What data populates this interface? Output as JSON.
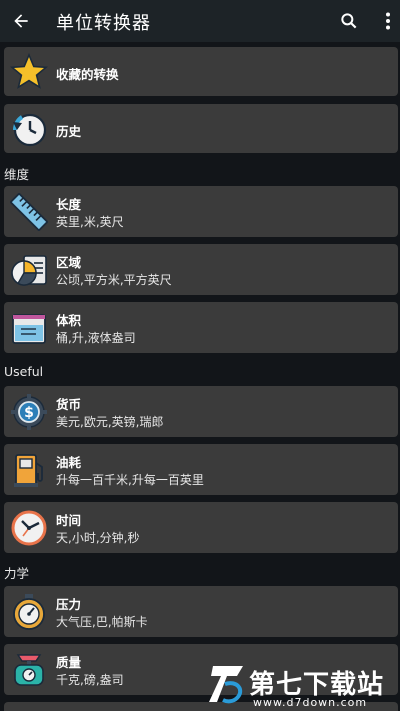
{
  "header": {
    "title": "单位转换器",
    "back_icon": "arrow-left-icon",
    "search_icon": "search-icon",
    "more_icon": "more-vert-icon"
  },
  "top_items": [
    {
      "name": "收藏的转换",
      "icon": "star-icon"
    },
    {
      "name": "历史",
      "icon": "history-icon"
    }
  ],
  "sections": [
    {
      "title": "维度",
      "items": [
        {
          "name": "长度",
          "units": "英里,米,英尺",
          "icon": "ruler-icon"
        },
        {
          "name": "区域",
          "units": "公顷,平方米,平方英尺",
          "icon": "area-chart-icon"
        },
        {
          "name": "体积",
          "units": "桶,升,液体盎司",
          "icon": "beaker-icon"
        }
      ]
    },
    {
      "title": "Useful",
      "items": [
        {
          "name": "货币",
          "units": "美元,欧元,英镑,瑞郎",
          "icon": "currency-gear-icon"
        },
        {
          "name": "油耗",
          "units": "升每一百千米,升每一百英里",
          "icon": "fuel-pump-icon"
        },
        {
          "name": "时间",
          "units": "天,小时,分钟,秒",
          "icon": "clock-icon"
        }
      ]
    },
    {
      "title": "力学",
      "items": [
        {
          "name": "压力",
          "units": "大气压,巴,帕斯卡",
          "icon": "pressure-gauge-icon"
        },
        {
          "name": "质量",
          "units": "千克,磅,盎司",
          "icon": "weight-scale-icon"
        }
      ]
    }
  ],
  "watermark": {
    "text": "第七下载站",
    "url": "www.d7down.com"
  }
}
